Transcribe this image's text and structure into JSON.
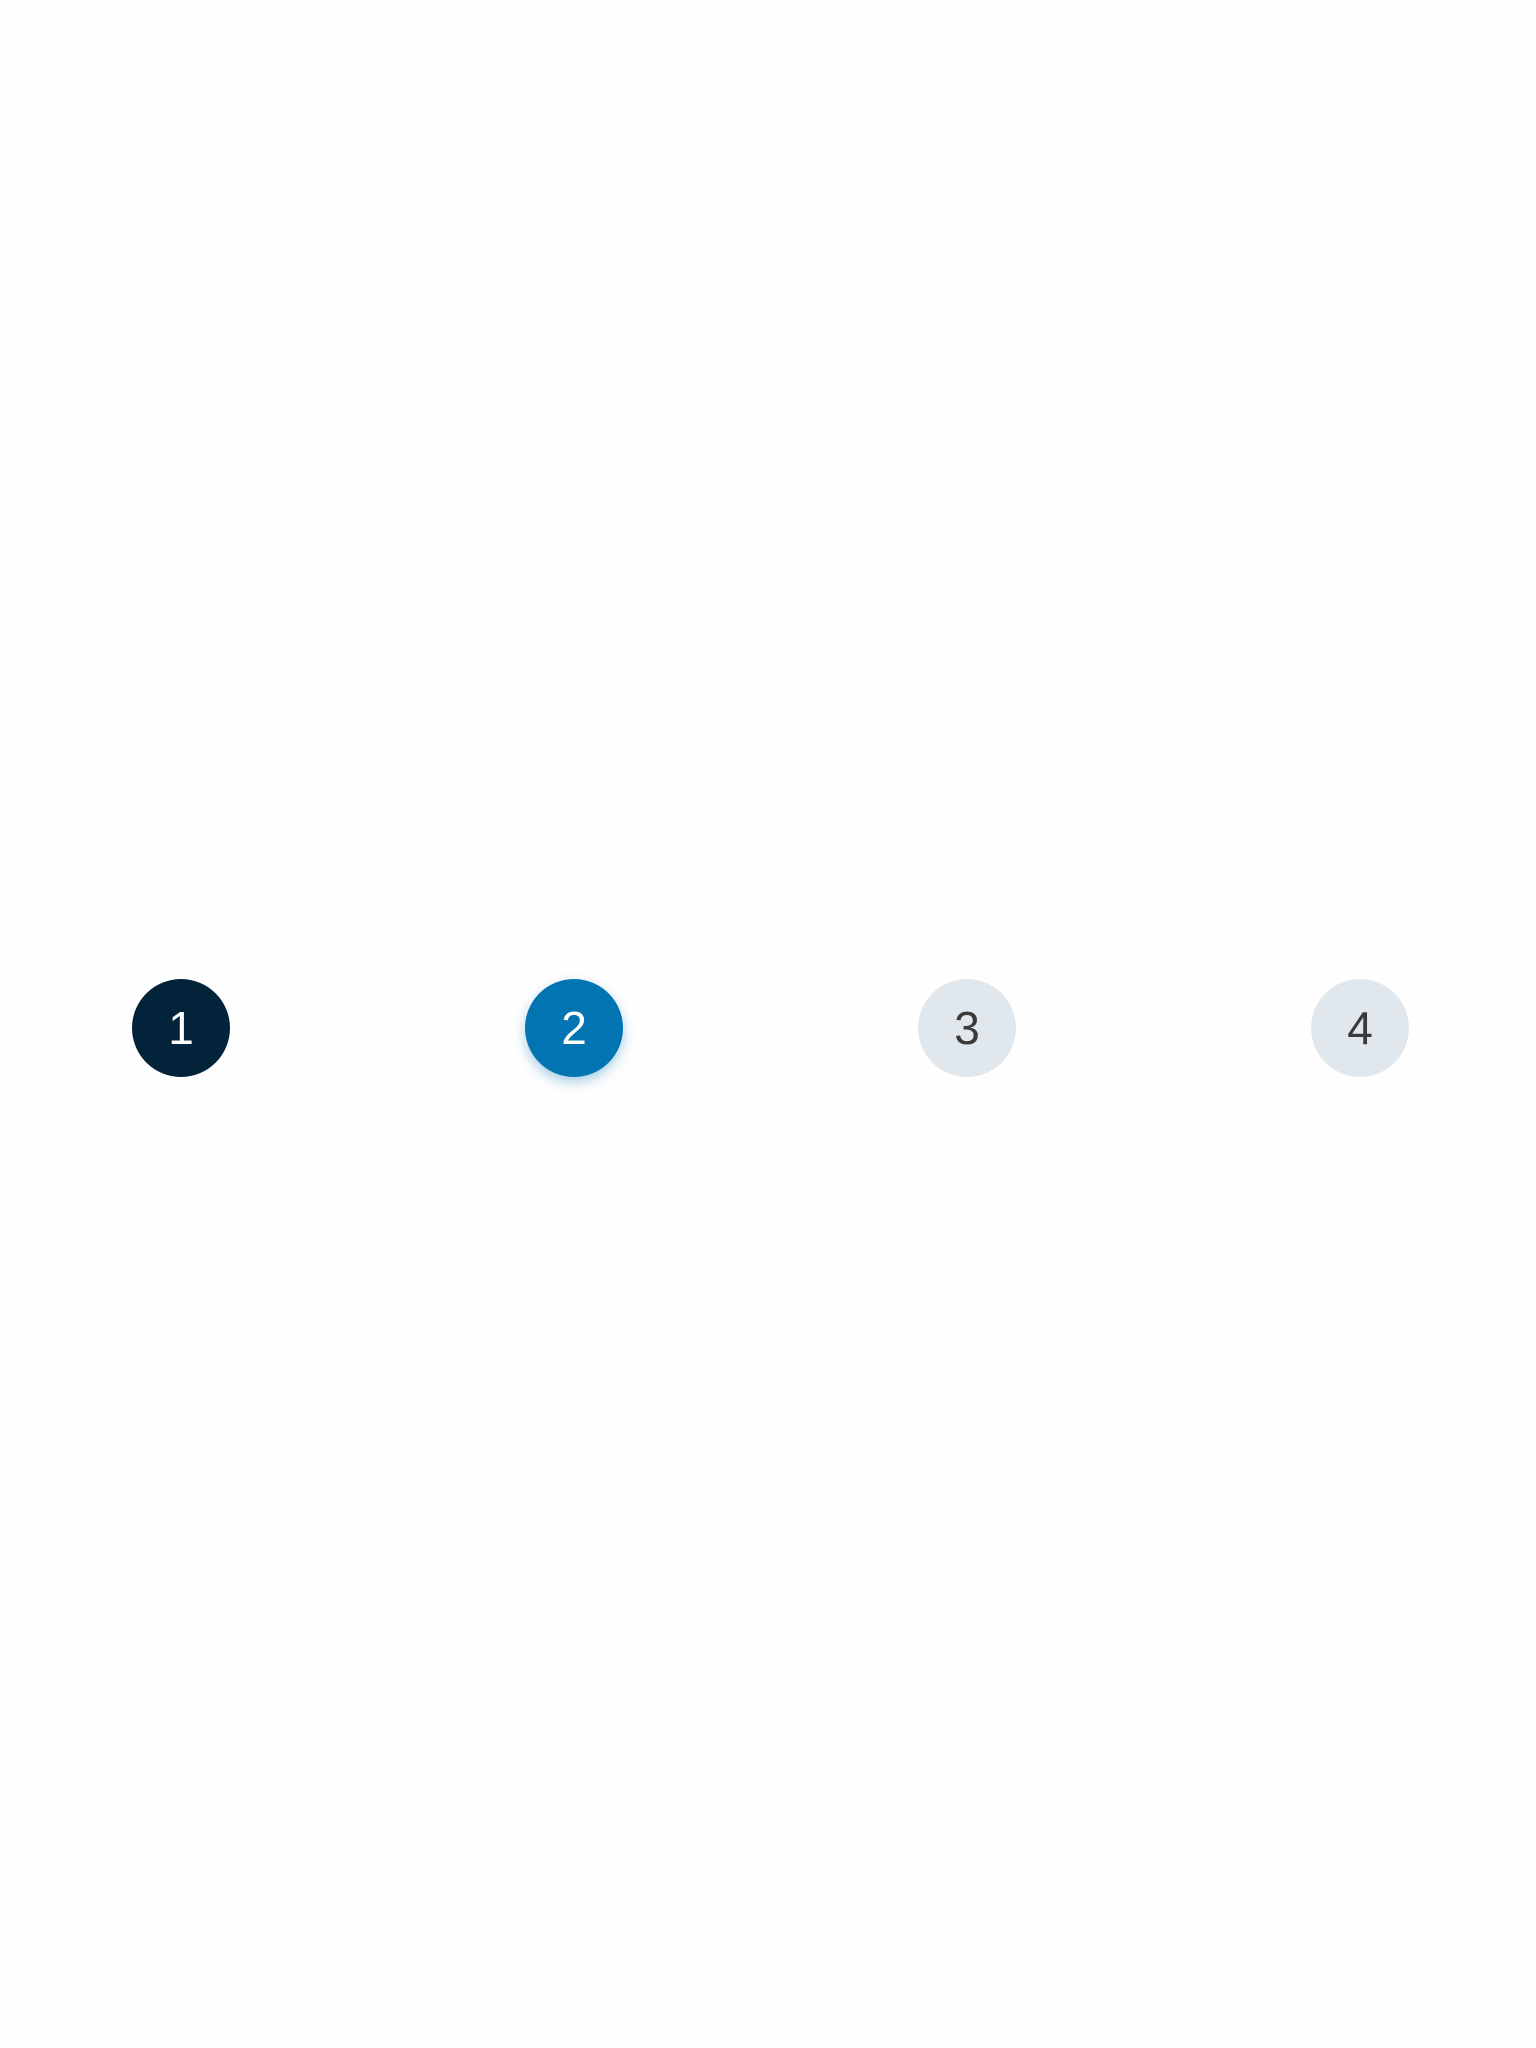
{
  "stepper": {
    "steps": [
      {
        "label": "1",
        "state": "completed",
        "background": "#02233a",
        "text_color": "#ffffff"
      },
      {
        "label": "2",
        "state": "current",
        "background": "#0374b2",
        "text_color": "#ffffff"
      },
      {
        "label": "3",
        "state": "upcoming",
        "background": "#e1e8ed",
        "text_color": "#3a3a3a"
      },
      {
        "label": "4",
        "state": "upcoming",
        "background": "#e1e8ed",
        "text_color": "#3a3a3a"
      }
    ]
  }
}
